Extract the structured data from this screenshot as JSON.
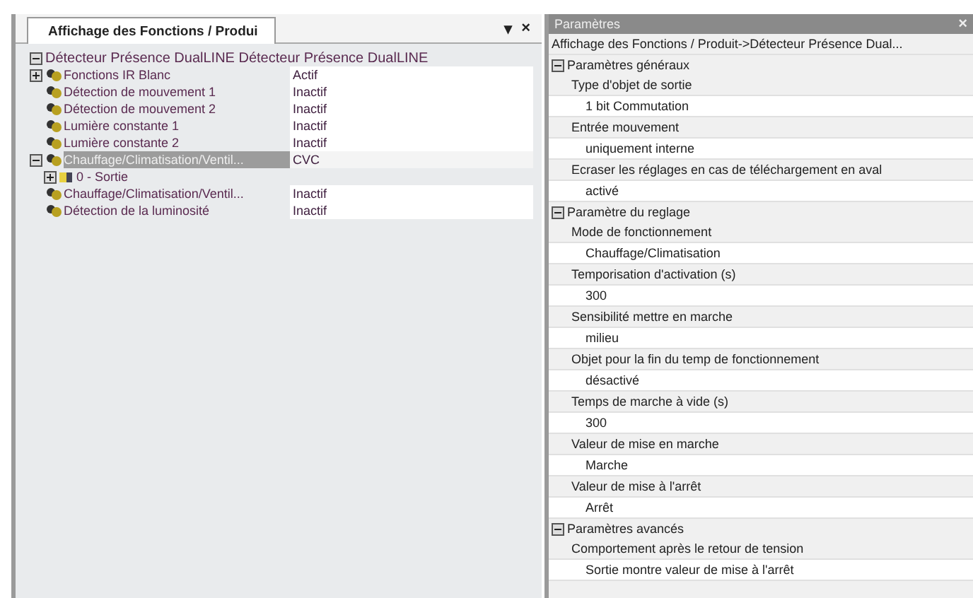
{
  "left_panel": {
    "tab": {
      "label": "Affichage des Fonctions / Produi",
      "selected": true
    },
    "menu_glyph": "▾",
    "close_glyph": "×",
    "tree": {
      "label": "Détecteur Présence DualLINE Détecteur Présence DualLINE",
      "expanded": true,
      "children": [
        {
          "label": "Fonctions IR Blanc",
          "value": "Actif",
          "expanded": false,
          "has_children": true,
          "selected": false
        },
        {
          "label": "Détection de mouvement 1",
          "value": "Inactif",
          "selected": false
        },
        {
          "label": "Détection de mouvement 2",
          "value": "Inactif",
          "selected": false
        },
        {
          "label": "Lumière constante 1",
          "value": "Inactif",
          "selected": false
        },
        {
          "label": "Lumière constante 2",
          "value": "Inactif",
          "selected": false
        },
        {
          "label": "Chauffage/Climatisation/Ventil...",
          "value": "CVC",
          "expanded": true,
          "has_children": true,
          "selected": true,
          "children": [
            {
              "label": "0 - Sortie",
              "kind": "object",
              "expanded": false,
              "has_children": true,
              "selected": false
            }
          ]
        },
        {
          "label": "Chauffage/Climatisation/Ventil...",
          "value": "Inactif",
          "selected": false
        },
        {
          "label": "Détection de la luminosité",
          "value": "Inactif",
          "selected": false
        }
      ]
    }
  },
  "right_panel": {
    "title": "Paramètres",
    "close_glyph": "×",
    "path": "Affichage des Fonctions / Produit->Détecteur Présence Dual...",
    "sections": [
      {
        "title": "Paramètres généraux",
        "expanded": true,
        "params": [
          {
            "label": "Type d'objet de sortie",
            "value": "1 bit Commutation"
          },
          {
            "label": "Entrée mouvement",
            "value": "uniquement interne"
          },
          {
            "label": "Ecraser les réglages en cas de téléchargement en aval",
            "value": "activé"
          }
        ]
      },
      {
        "title": "Paramètre du reglage",
        "expanded": true,
        "params": [
          {
            "label": "Mode de fonctionnement",
            "value": "Chauffage/Climatisation"
          },
          {
            "label": "Temporisation d'activation (s)",
            "value": "300"
          },
          {
            "label": "Sensibilité mettre en marche",
            "value": "milieu"
          },
          {
            "label": "Objet pour la fin du temp de fonctionnement",
            "value": "désactivé"
          },
          {
            "label": "Temps de marche à vide (s)",
            "value": "300"
          },
          {
            "label": "Valeur de mise en marche",
            "value": "Marche"
          },
          {
            "label": "Valeur de mise à l'arrêt",
            "value": "Arrêt"
          }
        ]
      },
      {
        "title": "Paramètres avancés",
        "expanded": true,
        "params": [
          {
            "label": "Comportement après le retour de tension",
            "value": "Sortie montre valeur de mise à l'arrêt"
          }
        ]
      }
    ]
  }
}
